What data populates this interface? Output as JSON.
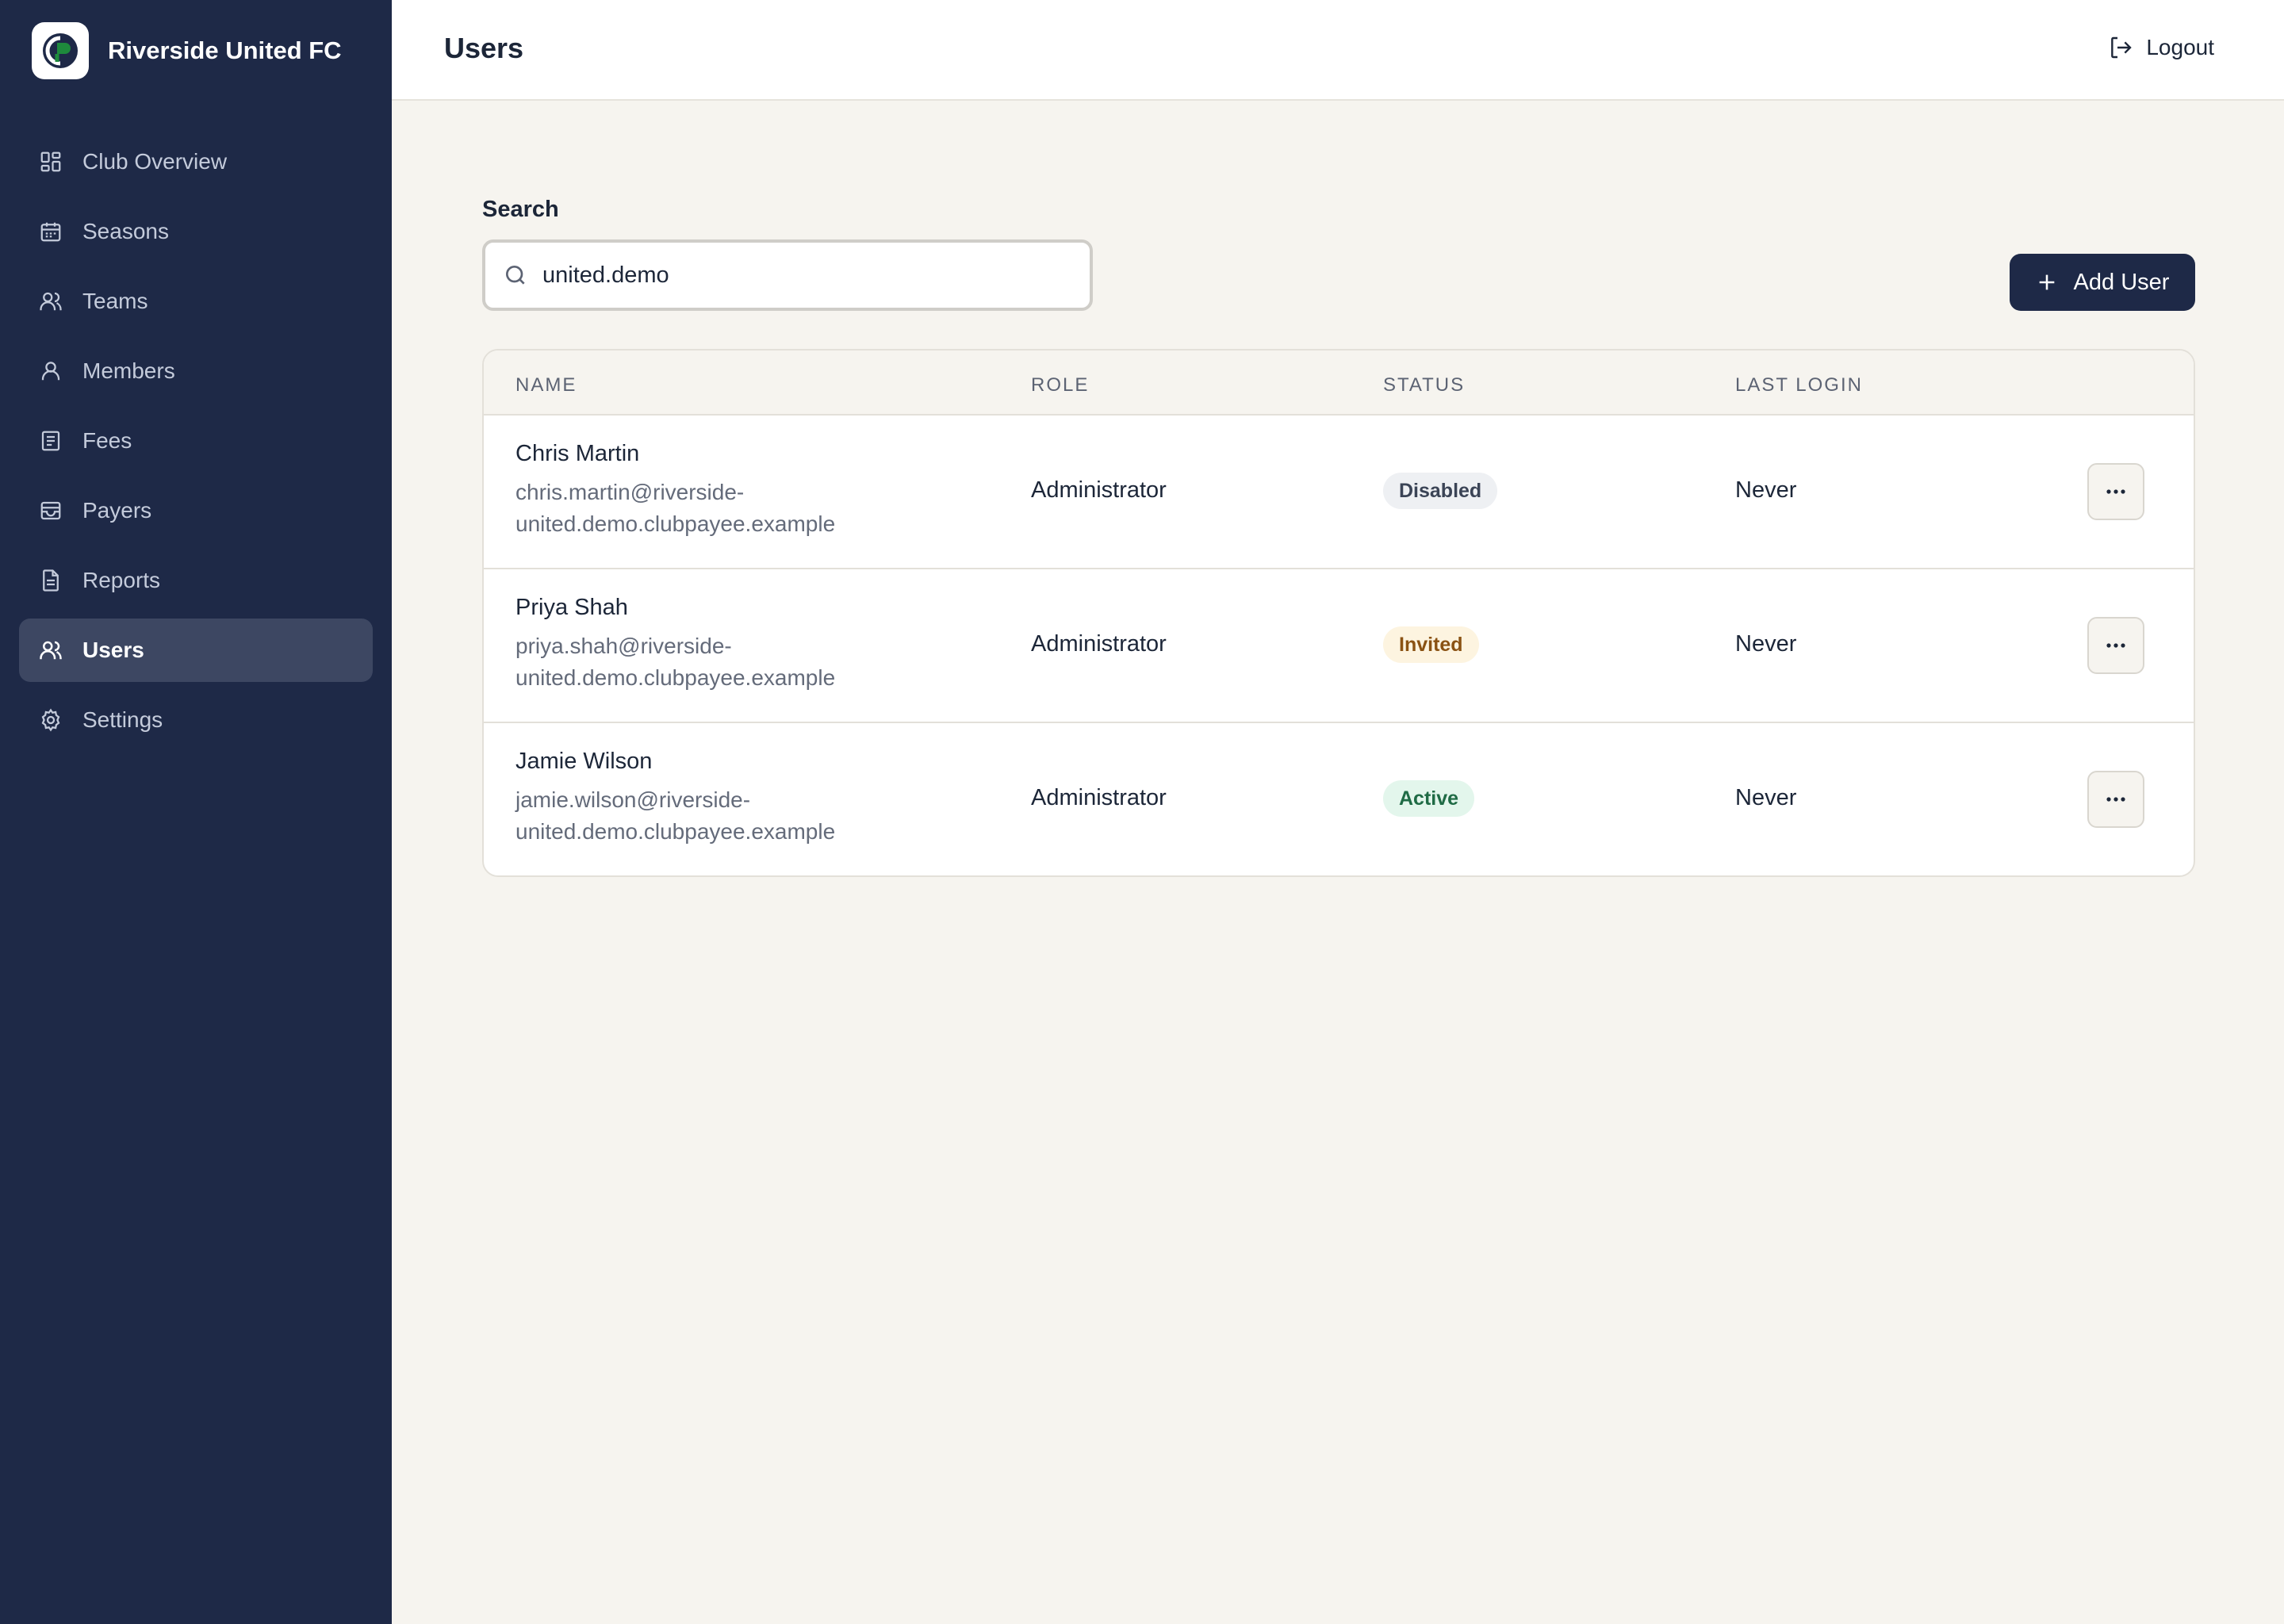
{
  "app": {
    "club_name": "Riverside United FC",
    "logo_glyph": "CP",
    "accent_color": "#1e2947",
    "logo_color": "#1e8a3c"
  },
  "sidebar": {
    "items": [
      {
        "label": "Club Overview",
        "icon": "grid-icon",
        "active": false
      },
      {
        "label": "Seasons",
        "icon": "calendar-icon",
        "active": false
      },
      {
        "label": "Teams",
        "icon": "users-icon",
        "active": false
      },
      {
        "label": "Members",
        "icon": "user-icon",
        "active": false
      },
      {
        "label": "Fees",
        "icon": "receipt-icon",
        "active": false
      },
      {
        "label": "Payers",
        "icon": "wallet-icon",
        "active": false
      },
      {
        "label": "Reports",
        "icon": "document-icon",
        "active": false
      },
      {
        "label": "Users",
        "icon": "users-icon",
        "active": true
      },
      {
        "label": "Settings",
        "icon": "gear-icon",
        "active": false
      }
    ]
  },
  "header": {
    "title": "Users",
    "logout_label": "Logout"
  },
  "search": {
    "label": "Search",
    "value": "united.demo",
    "placeholder": ""
  },
  "toolbar": {
    "add_user_label": "Add User"
  },
  "table": {
    "columns": [
      "Name",
      "Role",
      "Status",
      "Last Login"
    ],
    "rows": [
      {
        "name": "Chris Martin",
        "email_line1": "chris.martin@riverside-",
        "email_line2": "united.demo.clubpayee.example",
        "role": "Administrator",
        "status": "Disabled",
        "last_login": "Never"
      },
      {
        "name": "Priya Shah",
        "email_line1": "priya.shah@riverside-",
        "email_line2": "united.demo.clubpayee.example",
        "role": "Administrator",
        "status": "Invited",
        "last_login": "Never"
      },
      {
        "name": "Jamie Wilson",
        "email_line1": "jamie.wilson@riverside-",
        "email_line2": "united.demo.clubpayee.example",
        "role": "Administrator",
        "status": "Active",
        "last_login": "Never"
      }
    ]
  },
  "status_colors": {
    "Disabled": {
      "bg": "#eef0f3",
      "fg": "#3b4456"
    },
    "Invited": {
      "bg": "#fdf4e0",
      "fg": "#8a5213"
    },
    "Active": {
      "bg": "#e3f6ec",
      "fg": "#1f6b45"
    }
  }
}
